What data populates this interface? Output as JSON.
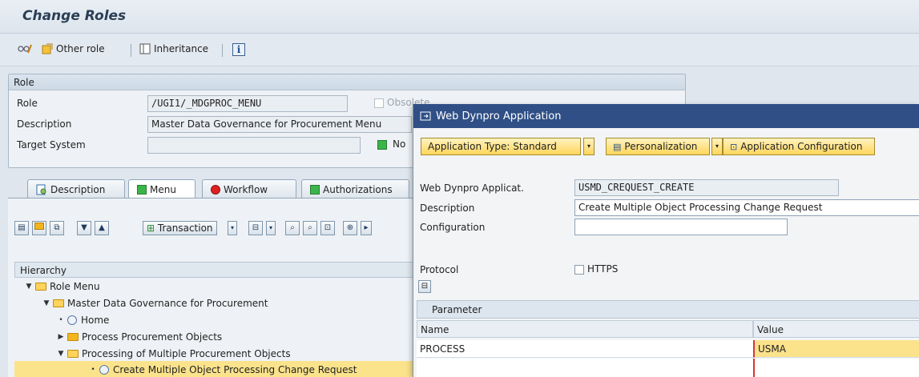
{
  "page_title": "Change Roles",
  "toolbar": {
    "other_role": "Other role",
    "inheritance": "Inheritance",
    "info": "i"
  },
  "role_group": {
    "header": "Role",
    "role_label": "Role",
    "role_value": "/UGI1/_MDGPROC_MENU",
    "obsolete_label": "Obsolete",
    "description_label": "Description",
    "description_value": "Master Data Governance for Procurement Menu",
    "target_label": "Target System",
    "target_value": "",
    "no_label": "No"
  },
  "tabs": [
    {
      "label": "Description"
    },
    {
      "label": "Menu"
    },
    {
      "label": "Workflow"
    },
    {
      "label": "Authorizations"
    }
  ],
  "menu_toolbar": {
    "transaction_label": "Transaction"
  },
  "hierarchy": {
    "header": "Hierarchy",
    "rows": [
      {
        "label": "Role Menu"
      },
      {
        "label": "Master Data Governance for Procurement"
      },
      {
        "label": "Home"
      },
      {
        "label": "Process  Procurement Objects"
      },
      {
        "label": "Processing of Multiple Procurement Objects"
      },
      {
        "label": "Create Multiple Object Processing Change Request"
      }
    ]
  },
  "dialog": {
    "title": "Web Dynpro Application",
    "app_type_button": "Application Type: Standard",
    "personalization_button": "Personalization",
    "app_config_button": "Application Configuration",
    "app_label": "Web Dynpro Applicat.",
    "app_value": "USMD_CREQUEST_CREATE",
    "description_label": "Description",
    "description_value": "Create Multiple Object Processing Change Request",
    "configuration_label": "Configuration",
    "configuration_value": "",
    "protocol_label": "Protocol",
    "https_label": "HTTPS",
    "parameter_header": "Parameter",
    "columns": [
      "Name",
      "Value"
    ],
    "rows": [
      {
        "name": "PROCESS",
        "value": "USMA"
      }
    ]
  }
}
